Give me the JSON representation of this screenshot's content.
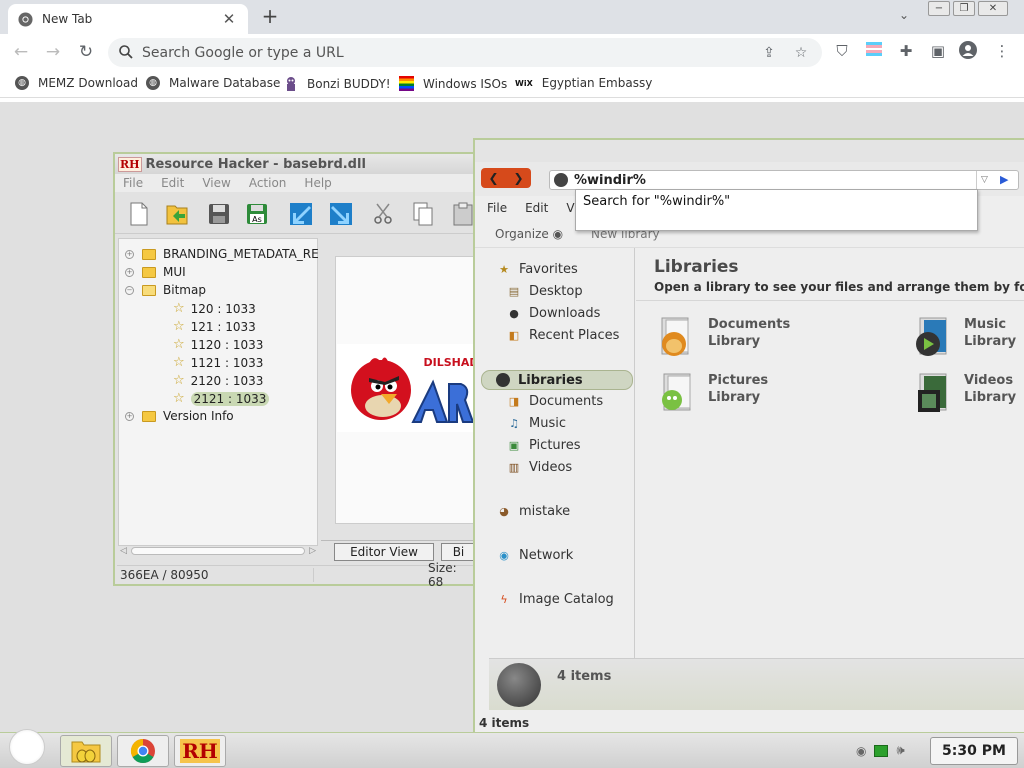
{
  "browser": {
    "tab": {
      "title": "New Tab",
      "close": "✕"
    },
    "new_tab": "+",
    "tab_search": "⌄",
    "window_controls": [
      "−",
      "❐",
      "✕"
    ],
    "omnibox": {
      "placeholder": "Search Google or type a URL"
    },
    "bookmarks": [
      {
        "label": "MEMZ Download",
        "icon": "globe-icon"
      },
      {
        "label": "Malware Database",
        "icon": "globe-icon"
      },
      {
        "label": "Bonzi BUDDY!",
        "icon": "bonzi-icon"
      },
      {
        "label": "Windows ISOs",
        "icon": "windows-flag-icon"
      },
      {
        "label": "Egyptian Embassy",
        "icon": "wix-icon"
      }
    ],
    "wix_glyph": "WiX"
  },
  "resource_hacker": {
    "title": "Resource Hacker - basebrd.dll",
    "logo": "RH",
    "menu": [
      "File",
      "Edit",
      "View",
      "Action",
      "Help"
    ],
    "tree": {
      "branding": "BRANDING_METADATA_RE",
      "mui": "MUI",
      "bitmap": "Bitmap",
      "bitmap_children": [
        "120 : 1033",
        "121 : 1033",
        "1120 : 1033",
        "1121 : 1033",
        "2120 : 1033",
        "2121 : 1033"
      ],
      "version": "Version Info"
    },
    "tabs": {
      "editor": "Editor View",
      "binary": "Bi"
    },
    "status": {
      "offset": "366EA / 80950",
      "size": "Size: 68"
    },
    "image_text": "DILSHAD"
  },
  "explorer": {
    "address": "%windir%",
    "suggestion": "Search for \"%windir%\"",
    "menu": [
      "File",
      "Edit",
      "Vie"
    ],
    "organize": "Organize ◉",
    "new_library": "New library",
    "nav": {
      "favorites": "Favorites",
      "favorites_items": [
        "Desktop",
        "Downloads",
        "Recent Places"
      ],
      "libraries": "Libraries",
      "libraries_items": [
        "Documents",
        "Music",
        "Pictures",
        "Videos"
      ],
      "mistake": "mistake",
      "network": "Network",
      "catalog": "Image Catalog"
    },
    "content": {
      "title": "Libraries",
      "subtitle": "Open a library to see your files and arrange them by folder, date, a",
      "libraries": [
        {
          "name": "Documents",
          "kind": "Library"
        },
        {
          "name": "Music",
          "kind": "Library"
        },
        {
          "name": "Pictures",
          "kind": "Library"
        },
        {
          "name": "Videos",
          "kind": "Library"
        }
      ]
    },
    "details_count": "4 items",
    "status_count": "4 items"
  },
  "taskbar": {
    "clock": "5:30 PM",
    "rh_label": "RH"
  },
  "colors": {
    "accent_green": "#b9cc9a",
    "nav_pill": "#d64a1b",
    "folder": "#f5c842"
  }
}
